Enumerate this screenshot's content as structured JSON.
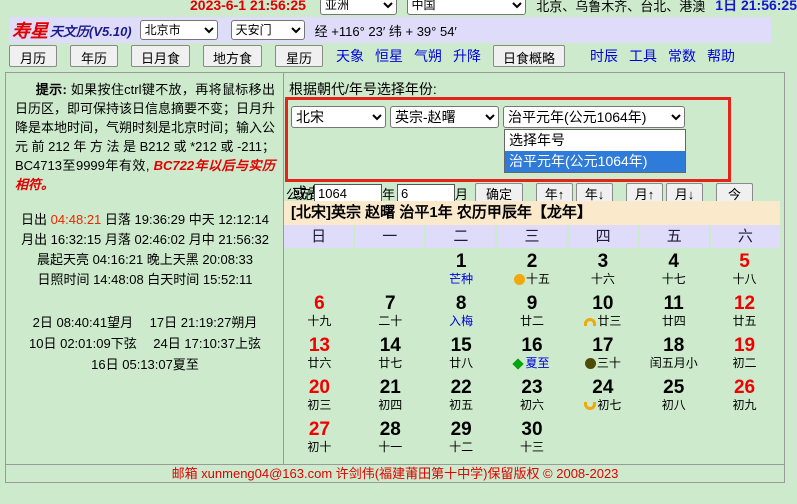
{
  "topbar": {
    "datetime": "2023-6-1 21:56:25",
    "region": "亚洲",
    "country": "中国",
    "cities": "北京、乌鲁木齐、台北、港澳",
    "day_time": "1日 21:56:25"
  },
  "header": {
    "app_name": "寿星",
    "app_version": "天文历(V5.10)",
    "city": "北京市",
    "site": "天安门",
    "coords": "经 +116° 23′  纬 + 39° 54′"
  },
  "toolbar": {
    "tabs": [
      "月历",
      "年历",
      "日月食",
      "地方食",
      "星历"
    ],
    "links_a": [
      "天象",
      "恒星",
      "气朔",
      "升降"
    ],
    "eclipse_button": "日食概略",
    "links_b": [
      "时辰",
      "工具",
      "常数",
      "帮助"
    ]
  },
  "sidebar": {
    "tip_bold": "提示:",
    "tip_text": " 如果按住ctrl键不放，再将鼠标移出日历区，即可保持该日信息摘要不变；日月升降是本地时间，气朔时刻是北京时间；输入公元前212年方法是B212或*212或-211；BC4713至9999年有效, ",
    "tip_red": "BC722年以后与实历相符。",
    "time_lines": [
      [
        {
          "text": "日出 "
        },
        {
          "text": "04:48:21",
          "color": "#e82800"
        },
        {
          "text": " 日落 19:36:29 中天 12:12:14"
        }
      ],
      [
        {
          "text": "月出 16:32:15 月落 02:46:02 月中 21:56:32"
        }
      ],
      [
        {
          "text": "晨起天亮 04:16:21 晚上天黑 20:08:33"
        }
      ],
      [
        {
          "text": "日照时间 14:48:08 白天时间 15:52:11"
        }
      ]
    ],
    "event_lines": [
      "2日 08:40:41望月　 17日 21:19:27朔月",
      "10日 02:01:09下弦　 24日 17:10:37上弦",
      "16日 05:13:07夏至"
    ]
  },
  "era_panel": {
    "section_label": "根据朝代/年号选择年份:",
    "dynasty": "北宋",
    "emperor": "英宗-赵曙",
    "era": "治平元年(公元1064年)",
    "era_options": [
      {
        "label": "选择年号",
        "selected": false
      },
      {
        "label": "治平元年(公元1064年)",
        "selected": true
      }
    ],
    "or_label": "或者直接输入"
  },
  "input_row": {
    "prefix": "公元",
    "year_value": "1064",
    "year_suffix": "年",
    "month_value": "6",
    "month_suffix": "月",
    "confirm": "确定",
    "year_up": "年↑",
    "year_down": "年↓",
    "month_up": "月↑",
    "month_down": "月↓",
    "today": "今"
  },
  "calendar": {
    "title": "[北宋]英宗 赵曙 治平1年 农历甲辰年【龙年】",
    "weekdays": [
      "日",
      "一",
      "二",
      "三",
      "四",
      "五",
      "六"
    ],
    "cells": [
      {},
      {},
      {
        "day": "1",
        "lunar": "芒种",
        "lunar_color": "blue"
      },
      {
        "day": "2",
        "lunar": "十五",
        "icon": "full-moon"
      },
      {
        "day": "3",
        "lunar": "十六"
      },
      {
        "day": "4",
        "lunar": "十七"
      },
      {
        "day": "5",
        "red": true,
        "lunar": "十八"
      },
      {
        "day": "6",
        "red": true,
        "lunar": "十九"
      },
      {
        "day": "7",
        "lunar": "二十"
      },
      {
        "day": "8",
        "lunar": "入梅",
        "lunar_color": "blue"
      },
      {
        "day": "9",
        "lunar": "廿二"
      },
      {
        "day": "10",
        "lunar": "廿三",
        "icon": "last-quarter"
      },
      {
        "day": "11",
        "lunar": "廿四"
      },
      {
        "day": "12",
        "red": true,
        "lunar": "廿五"
      },
      {
        "day": "13",
        "red": true,
        "lunar": "廿六"
      },
      {
        "day": "14",
        "lunar": "廿七"
      },
      {
        "day": "15",
        "lunar": "廿八"
      },
      {
        "day": "16",
        "lunar": "夏至",
        "lunar_color": "blue",
        "icon": "solar-term"
      },
      {
        "day": "17",
        "lunar": "三十",
        "icon": "new-moon"
      },
      {
        "day": "18",
        "lunar": "闰五月小"
      },
      {
        "day": "19",
        "red": true,
        "lunar": "初二"
      },
      {
        "day": "20",
        "red": true,
        "lunar": "初三"
      },
      {
        "day": "21",
        "lunar": "初四"
      },
      {
        "day": "22",
        "lunar": "初五"
      },
      {
        "day": "23",
        "lunar": "初六"
      },
      {
        "day": "24",
        "lunar": "初七",
        "icon": "first-quarter"
      },
      {
        "day": "25",
        "lunar": "初八"
      },
      {
        "day": "26",
        "red": true,
        "lunar": "初九"
      },
      {
        "day": "27",
        "red": true,
        "lunar": "初十"
      },
      {
        "day": "28",
        "lunar": "十一"
      },
      {
        "day": "29",
        "lunar": "十二"
      },
      {
        "day": "30",
        "lunar": "十三"
      },
      {},
      {},
      {}
    ]
  },
  "footer": {
    "text": "邮箱 xunmeng04@163.com 许剑伟(福建莆田第十中学)保留版权 © 2008-2023"
  },
  "colors": {
    "page_bg": "#cdeacd",
    "lavender_strip": "#dedcf8",
    "calendar_title_bg": "#fbe9cc",
    "highlight_box_red": "#e3241b",
    "selection_blue": "#2f7bd9",
    "weekend_red": "#f00000",
    "link_blue": "#0000e0",
    "moon_gold": "#efa90c",
    "new_moon_dark": "#4d4b05",
    "solar_term_green": "#04a310"
  }
}
